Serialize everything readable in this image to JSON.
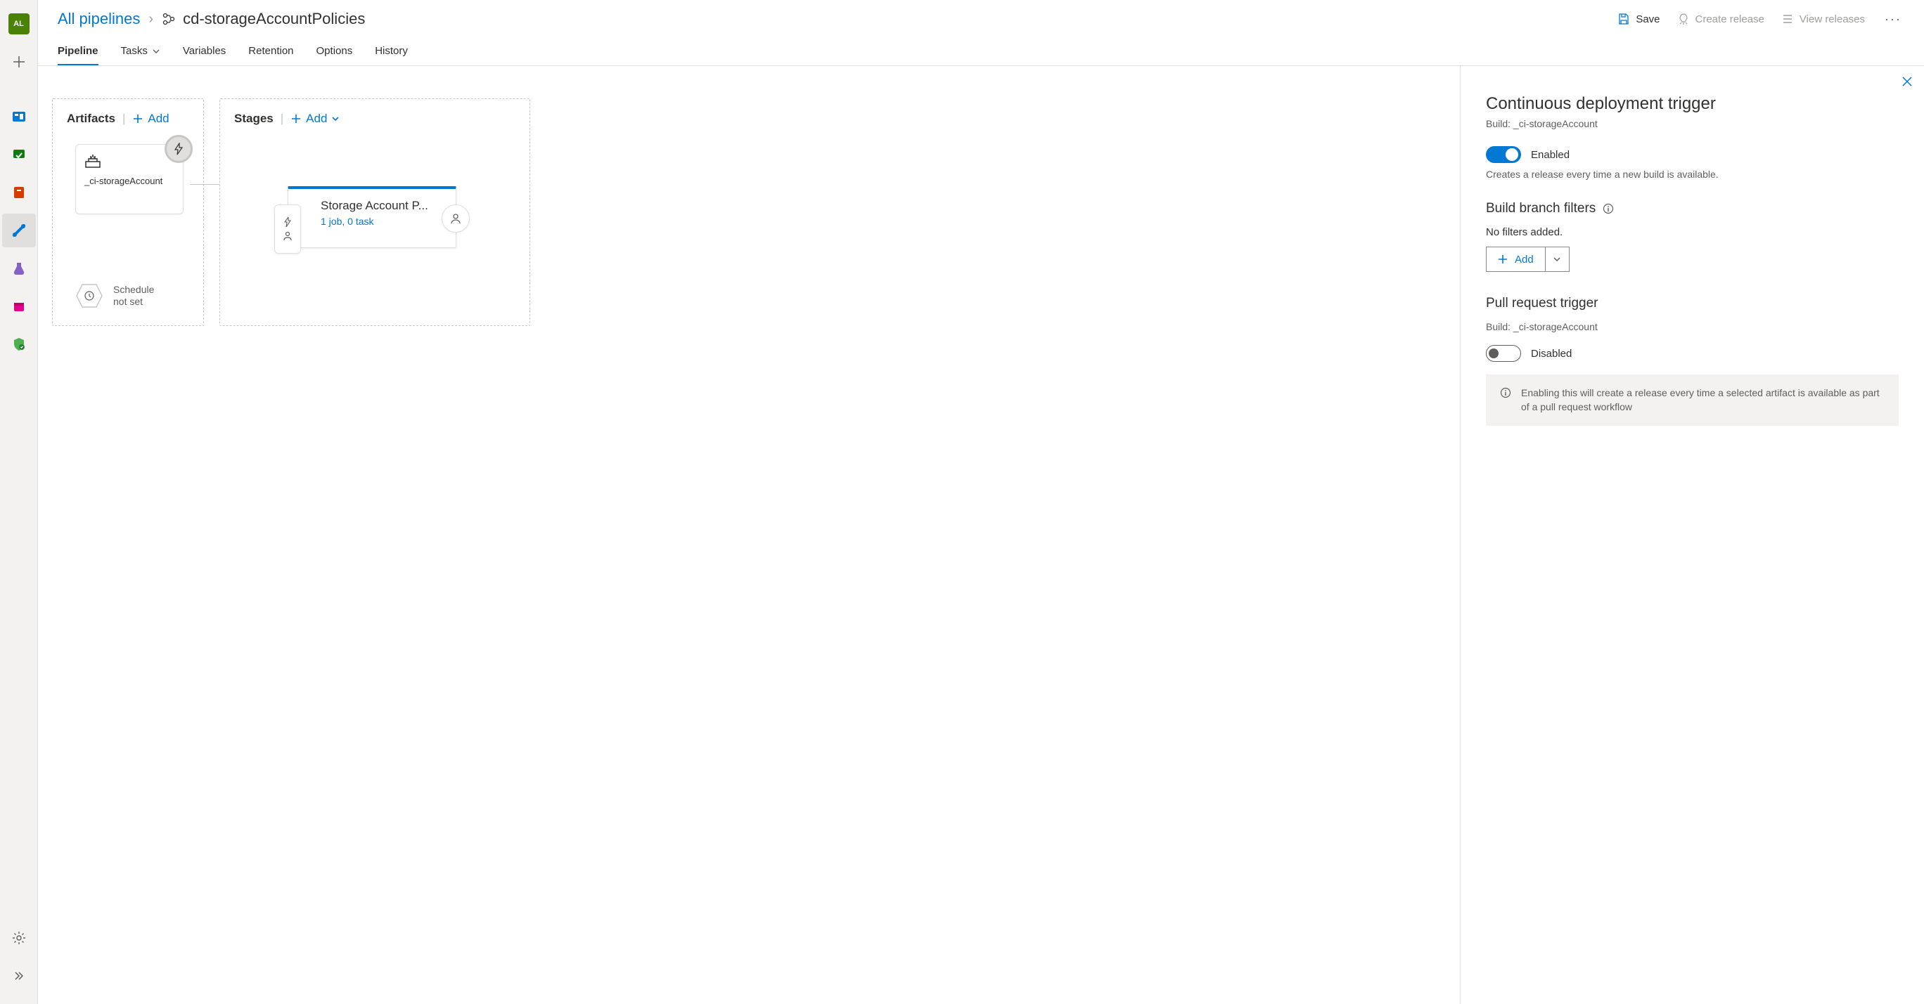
{
  "avatar_initials": "AL",
  "breadcrumb": {
    "root": "All pipelines",
    "current": "cd-storageAccountPolicies"
  },
  "toolbar": {
    "save": "Save",
    "create_release": "Create release",
    "view_releases": "View releases"
  },
  "tabs": [
    "Pipeline",
    "Tasks",
    "Variables",
    "Retention",
    "Options",
    "History"
  ],
  "artifacts": {
    "header": "Artifacts",
    "add": "Add",
    "card_name": "_ci-storageAccount",
    "schedule_l1": "Schedule",
    "schedule_l2": "not set"
  },
  "stages": {
    "header": "Stages",
    "add": "Add",
    "card_title": "Storage Account P...",
    "card_sub": "1 job, 0 task"
  },
  "panel": {
    "title": "Continuous deployment trigger",
    "build_prefix": "Build: ",
    "build_name": "_ci-storageAccount",
    "enabled_label": "Enabled",
    "enabled_desc": "Creates a release every time a new build is available.",
    "branch_filters_header": "Build branch filters",
    "no_filters": "No filters added.",
    "add": "Add",
    "pr_header": "Pull request trigger",
    "disabled_label": "Disabled",
    "pr_info": "Enabling this will create a release every time a selected artifact is available as part of a pull request workflow"
  }
}
